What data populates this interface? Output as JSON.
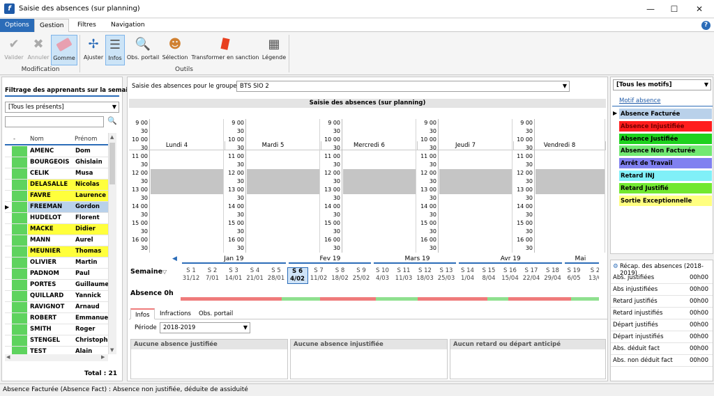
{
  "window": {
    "title": "Saisie des absences (sur planning)",
    "app_icon": "f"
  },
  "menu": {
    "tabs": [
      "Options",
      "Gestion",
      "Filtres",
      "Navigation"
    ],
    "help": "?"
  },
  "ribbon": {
    "buttons": [
      "Valider",
      "Annuler",
      "Gomme",
      "Ajuster",
      "Infos",
      "Obs. portail",
      "Sélection",
      "Transformer en sanction",
      "Légende"
    ],
    "groups": [
      "Modification",
      "Outils"
    ]
  },
  "left": {
    "title": "Filtrage des apprenants sur la semai...",
    "filter": "[Tous les présents]",
    "columns": [
      "-",
      "Nom",
      "Prénom"
    ],
    "students": [
      {
        "nom": "AMENC",
        "prenom": "Dom",
        "hl": ""
      },
      {
        "nom": "BOURGEOIS",
        "prenom": "Ghislain",
        "hl": ""
      },
      {
        "nom": "CELIK",
        "prenom": "Musa",
        "hl": ""
      },
      {
        "nom": "DELASALLE",
        "prenom": "Nicolas",
        "hl": "y"
      },
      {
        "nom": "FAVRE",
        "prenom": "Laurence",
        "hl": "y"
      },
      {
        "nom": "FREEMAN",
        "prenom": "Gordon",
        "hl": "s"
      },
      {
        "nom": "HUDELOT",
        "prenom": "Florent",
        "hl": ""
      },
      {
        "nom": "MACKE",
        "prenom": "Didier",
        "hl": "y"
      },
      {
        "nom": "MANN",
        "prenom": "Aurel",
        "hl": ""
      },
      {
        "nom": "MEUNIER",
        "prenom": "Thomas",
        "hl": "y"
      },
      {
        "nom": "OLIVIER",
        "prenom": "Martin",
        "hl": ""
      },
      {
        "nom": "PADNOM",
        "prenom": "Paul",
        "hl": ""
      },
      {
        "nom": "PORTES",
        "prenom": "Guillaume",
        "hl": ""
      },
      {
        "nom": "QUILLARD",
        "prenom": "Yannick",
        "hl": ""
      },
      {
        "nom": "RAVIGNOT",
        "prenom": "Arnaud",
        "hl": ""
      },
      {
        "nom": "ROBERT",
        "prenom": "Emmanuel",
        "hl": ""
      },
      {
        "nom": "SMITH",
        "prenom": "Roger",
        "hl": ""
      },
      {
        "nom": "STENGEL",
        "prenom": "Christophe",
        "hl": ""
      },
      {
        "nom": "TEST",
        "prenom": "Alain",
        "hl": ""
      }
    ],
    "total": "Total : 21"
  },
  "center": {
    "group_label": "Saisie des absences pour le groupe",
    "group_value": "BTS SIO 2",
    "plan_title": "Saisie des absences (sur planning)",
    "days": [
      "Lundi 4",
      "Mardi 5",
      "Mercredi 6",
      "Jeudi 7",
      "Vendredi 8"
    ],
    "times": [
      "9 00",
      "30",
      "10 00",
      "30",
      "11 00",
      "30",
      "12 00",
      "30",
      "13 00",
      "30",
      "14 00",
      "30",
      "15 00",
      "30",
      "16 00",
      "30"
    ],
    "semaine_label": "Semaine",
    "absence_label": "Absence 0h",
    "months": [
      "Jan 19",
      "Fev 19",
      "Mars 19",
      "Avr 19",
      "Mai"
    ],
    "weeks": [
      {
        "s": "S 1",
        "d": "31/12"
      },
      {
        "s": "S 2",
        "d": "7/01"
      },
      {
        "s": "S 3",
        "d": "14/01"
      },
      {
        "s": "S 4",
        "d": "21/01"
      },
      {
        "s": "S 5",
        "d": "28/01"
      },
      {
        "s": "S 6",
        "d": "4/02"
      },
      {
        "s": "S 7",
        "d": "11/02"
      },
      {
        "s": "S 8",
        "d": "18/02"
      },
      {
        "s": "S 9",
        "d": "25/02"
      },
      {
        "s": "S 10",
        "d": "4/03"
      },
      {
        "s": "S 11",
        "d": "11/03"
      },
      {
        "s": "S 12",
        "d": "18/03"
      },
      {
        "s": "S 13",
        "d": "25/03"
      },
      {
        "s": "S 14",
        "d": "1/04"
      },
      {
        "s": "S 15",
        "d": "8/04"
      },
      {
        "s": "S 16",
        "d": "15/04"
      },
      {
        "s": "S 17",
        "d": "22/04"
      },
      {
        "s": "S 18",
        "d": "29/04"
      },
      {
        "s": "S 19",
        "d": "6/05"
      },
      {
        "s": "S 2",
        "d": "13/0"
      }
    ],
    "bottom_tabs": [
      "Infos",
      "Infractions",
      "Obs. portail"
    ],
    "periode_label": "Période",
    "periode_value": "2018-2019",
    "boxes": [
      "Aucune absence justifiée",
      "Aucune absence injustifiée",
      "Aucun retard ou départ anticipé"
    ]
  },
  "right": {
    "filter": "[Tous les motifs]",
    "motif_header": "Motif absence",
    "motifs": [
      {
        "label": "Absence Facturée",
        "color": "#b9d1ea",
        "text": "#000"
      },
      {
        "label": "Absence Injustifiée",
        "color": "#ff1e1e",
        "text": "#700000"
      },
      {
        "label": "Absence Justifiée",
        "color": "#1ed21e",
        "text": "#000"
      },
      {
        "label": "Absence Non Facturée",
        "color": "#72e872",
        "text": "#000"
      },
      {
        "label": "Arrêt de Travail",
        "color": "#8080f0",
        "text": "#000"
      },
      {
        "label": "Retard INJ",
        "color": "#80f0f8",
        "text": "#000"
      },
      {
        "label": "Retard Justifié",
        "color": "#72e830",
        "text": "#000"
      },
      {
        "label": "Sortie Exceptionnelle",
        "color": "#ffff80",
        "text": "#000"
      }
    ],
    "recap_title": "Récap. des absences (2018-2019)",
    "recap": [
      {
        "l": "Abs. justifiées",
        "v": "00h00"
      },
      {
        "l": "Abs injustifiées",
        "v": "00h00"
      },
      {
        "l": "Retard justifiés",
        "v": "00h00"
      },
      {
        "l": "Retard injustifiés",
        "v": "00h00"
      },
      {
        "l": "Départ justifiés",
        "v": "00h00"
      },
      {
        "l": "Départ injustifiés",
        "v": "00h00"
      },
      {
        "l": "Abs. déduit fact",
        "v": "00h00"
      },
      {
        "l": "Abs. non déduit fact",
        "v": "00h00"
      }
    ]
  },
  "status": "Absence Facturée (Absence Fact) : Absence non justifiée, déduite de assiduité"
}
